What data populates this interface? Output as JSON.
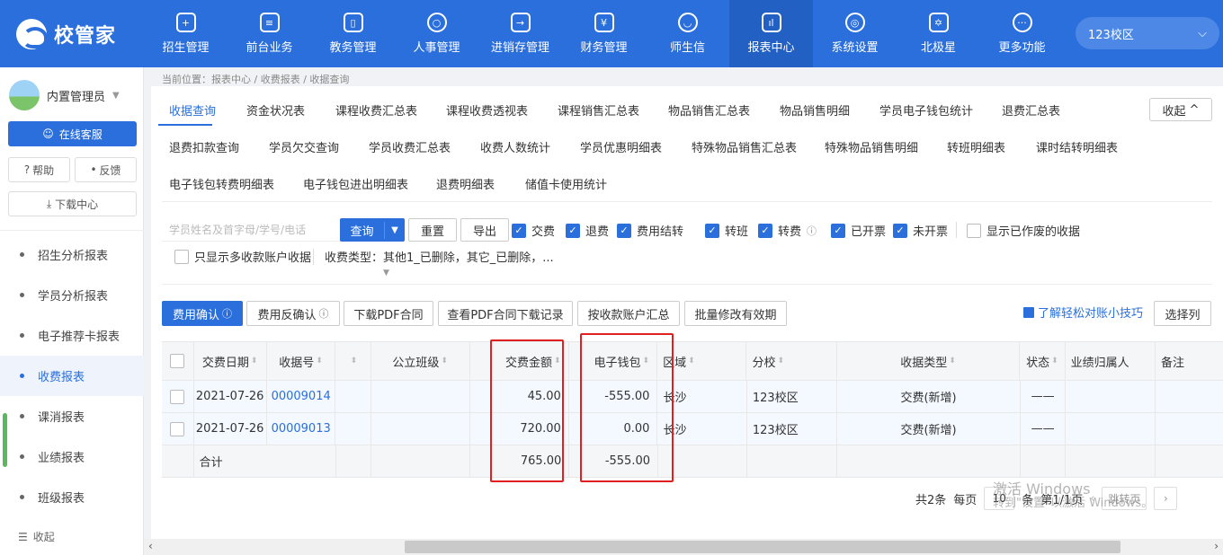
{
  "app": {
    "logo_text": "校管家",
    "campus": "123校区"
  },
  "nav": [
    {
      "label": "招生管理",
      "icon": "person-plus-icon",
      "glyph": "+"
    },
    {
      "label": "前台业务",
      "icon": "monitor-icon",
      "glyph": "≡"
    },
    {
      "label": "教务管理",
      "icon": "book-icon",
      "glyph": "▯"
    },
    {
      "label": "人事管理",
      "icon": "person-icon",
      "glyph": "○"
    },
    {
      "label": "进销存管理",
      "icon": "exchange-icon",
      "glyph": "→"
    },
    {
      "label": "财务管理",
      "icon": "money-bag-icon",
      "glyph": "¥"
    },
    {
      "label": "师生信",
      "icon": "chat-bubble-icon",
      "glyph": "◡"
    },
    {
      "label": "报表中心",
      "icon": "bar-chart-icon",
      "glyph": "ıl"
    },
    {
      "label": "系统设置",
      "icon": "gear-icon",
      "glyph": "◎"
    },
    {
      "label": "北极星",
      "icon": "star-icon",
      "glyph": "✡"
    },
    {
      "label": "更多功能",
      "icon": "more-icon",
      "glyph": "···"
    }
  ],
  "sidebar": {
    "user": "内置管理员",
    "online_service": "在线客服",
    "help": "帮助",
    "feedback": "反馈",
    "download_center": "下载中心",
    "menu": [
      "招生分析报表",
      "学员分析报表",
      "电子推荐卡报表",
      "收费报表",
      "课消报表",
      "业绩报表",
      "班级报表"
    ],
    "active_index": 3,
    "collapse": "收起"
  },
  "breadcrumb": "当前位置：报表中心 / 收费报表 / 收据查询",
  "tabs": [
    "收据查询",
    "资金状况表",
    "课程收费汇总表",
    "课程收费透视表",
    "课程销售汇总表",
    "物品销售汇总表",
    "物品销售明细",
    "学员电子钱包统计",
    "退费汇总表",
    "退费扣款查询",
    "学员欠交查询",
    "学员收费汇总表",
    "收费人数统计",
    "学员优惠明细表",
    "特殊物品销售汇总表",
    "特殊物品销售明细",
    "转班明细表",
    "课时结转明细表",
    "电子钱包转费明细表",
    "电子钱包进出明细表",
    "退费明细表",
    "储值卡使用统计"
  ],
  "fold_btn": "收起",
  "filters": {
    "search_placeholder": "学员姓名及首字母/学号/电话",
    "query": "查询",
    "reset": "重置",
    "export": "导出",
    "checks": [
      {
        "label": "交费",
        "on": true
      },
      {
        "label": "退费",
        "on": true
      },
      {
        "label": "费用结转",
        "on": true
      },
      {
        "label": "转班",
        "on": true
      },
      {
        "label": "转费",
        "on": true
      },
      {
        "label": "已开票",
        "on": true
      },
      {
        "label": "未开票",
        "on": true
      },
      {
        "label": "显示已作废的收据",
        "on": false
      },
      {
        "label": "只显示多收款账户收据",
        "on": false
      }
    ],
    "type_label": "收费类型：",
    "type_value": "其他1_已删除，其它_已删除，..."
  },
  "actions": {
    "confirm": "费用确认",
    "unconfirm": "费用反确认",
    "download_pdf": "下载PDF合同",
    "pdf_records": "查看PDF合同下载记录",
    "by_account": "按收款账户汇总",
    "batch_edit": "批量修改有效期",
    "tip": "了解轻松对账小技巧",
    "choose_cols": "选择列"
  },
  "table": {
    "columns": [
      "交费日期",
      "收据号",
      "公立班级",
      "交费金额",
      "电子钱包",
      "区域",
      "分校",
      "收据类型",
      "状态",
      "业绩归属人",
      "备注"
    ],
    "rows": [
      {
        "date": "2021-07-26",
        "receipt": "00009014",
        "class": "",
        "amount": "45.00",
        "wallet": "-555.00",
        "area": "长沙",
        "branch": "123校区",
        "type": "交费(新增)",
        "status": "——",
        "owner": "",
        "note": ""
      },
      {
        "date": "2021-07-26",
        "receipt": "00009013",
        "class": "",
        "amount": "720.00",
        "wallet": "0.00",
        "area": "长沙",
        "branch": "123校区",
        "type": "交费(新增)",
        "status": "——",
        "owner": "",
        "note": ""
      }
    ],
    "total": {
      "label": "合计",
      "amount": "765.00",
      "wallet": "-555.00"
    }
  },
  "pager": {
    "total": "共2条",
    "per_page": "每页",
    "size": "10",
    "unit": "条",
    "page": "第1/1页",
    "jump": "跳转页"
  },
  "watermark": {
    "line1": "激活 Windows",
    "line2": "转到\"设置\"以激活 Windows。"
  },
  "colors": {
    "brand": "#2a6fdb",
    "highlight": "#e02020"
  }
}
